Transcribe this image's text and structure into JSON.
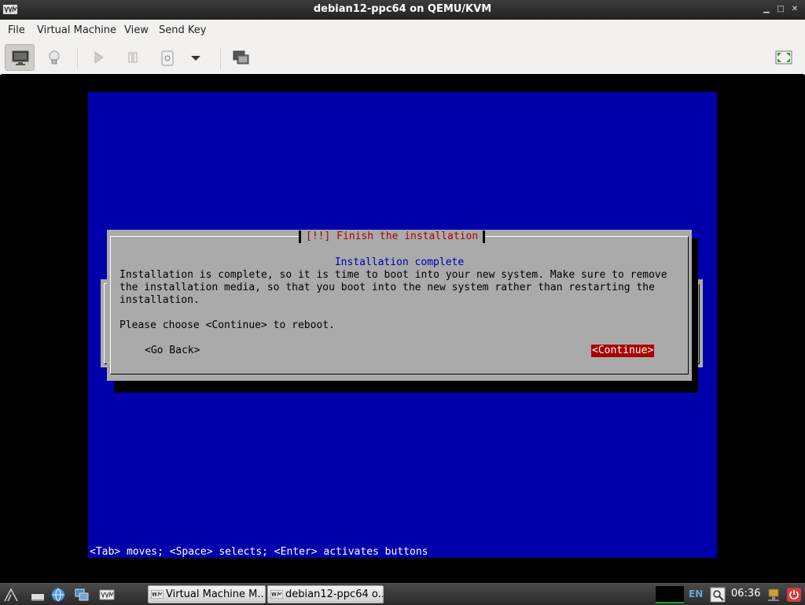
{
  "window": {
    "title": "debian12-ppc64 on QEMU/KVM"
  },
  "menu": {
    "items": [
      "File",
      "Virtual Machine",
      "View",
      "Send Key"
    ]
  },
  "toolbar": {
    "icons": [
      "console-icon",
      "details-lightbulb-icon",
      "run-icon",
      "pause-icon",
      "power-icon",
      "power-menu-chevron-icon",
      "snapshots-icon",
      "fullscreen-icon"
    ]
  },
  "installer": {
    "dialog_title": "[!!] Finish the installation",
    "subtitle": "Installation complete",
    "body": "Installation is complete, so it is time to boot into your new system. Make sure to remove\nthe installation media, so that you boot into the new system rather than restarting the\ninstallation.",
    "prompt": "Please choose <Continue> to reboot.",
    "go_back": "<Go Back>",
    "continue": "<Continue>",
    "status_line": "<Tab> moves; <Space> selects; <Enter> activates buttons",
    "colors": {
      "background": "#0000aa",
      "dialog": "#aaaaaa",
      "title": "#aa0000",
      "selected": "#aa0000"
    }
  },
  "taskbar": {
    "tasks": [
      "Virtual Machine M...",
      "debian12-ppc64 o..."
    ],
    "language": "EN",
    "clock": "06:36"
  }
}
